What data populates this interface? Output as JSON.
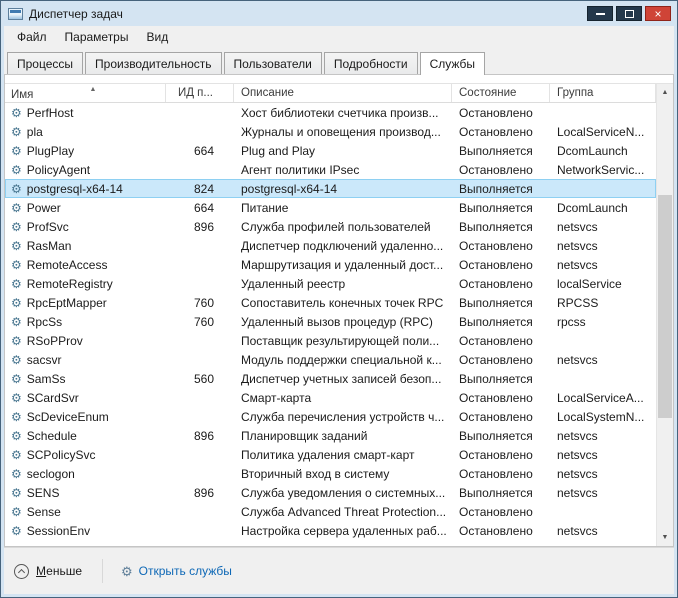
{
  "window": {
    "title": "Диспетчер задач"
  },
  "menu": {
    "items": [
      {
        "label": "Файл"
      },
      {
        "label": "Параметры"
      },
      {
        "label": "Вид"
      }
    ]
  },
  "tabs": {
    "items": [
      {
        "label": "Процессы",
        "active": false
      },
      {
        "label": "Производительность",
        "active": false
      },
      {
        "label": "Пользователи",
        "active": false
      },
      {
        "label": "Подробности",
        "active": false
      },
      {
        "label": "Службы",
        "active": true
      }
    ]
  },
  "table": {
    "columns": [
      {
        "label": "Имя",
        "sort": "asc"
      },
      {
        "label": "ИД п..."
      },
      {
        "label": "Описание"
      },
      {
        "label": "Состояние"
      },
      {
        "label": "Группа"
      }
    ],
    "rows": [
      {
        "name": "PerfHost",
        "pid": "",
        "desc": "Хост библиотеки счетчика произв...",
        "status": "Остановлено",
        "group": "",
        "selected": false
      },
      {
        "name": "pla",
        "pid": "",
        "desc": "Журналы и оповещения производ...",
        "status": "Остановлено",
        "group": "LocalServiceN...",
        "selected": false
      },
      {
        "name": "PlugPlay",
        "pid": "664",
        "desc": "Plug and Play",
        "status": "Выполняется",
        "group": "DcomLaunch",
        "selected": false
      },
      {
        "name": "PolicyAgent",
        "pid": "",
        "desc": "Агент политики IPsec",
        "status": "Остановлено",
        "group": "NetworkServic...",
        "selected": false
      },
      {
        "name": "postgresql-x64-14",
        "pid": "824",
        "desc": "postgresql-x64-14",
        "status": "Выполняется",
        "group": "",
        "selected": true
      },
      {
        "name": "Power",
        "pid": "664",
        "desc": "Питание",
        "status": "Выполняется",
        "group": "DcomLaunch",
        "selected": false
      },
      {
        "name": "ProfSvc",
        "pid": "896",
        "desc": "Служба профилей пользователей",
        "status": "Выполняется",
        "group": "netsvcs",
        "selected": false
      },
      {
        "name": "RasMan",
        "pid": "",
        "desc": "Диспетчер подключений удаленно...",
        "status": "Остановлено",
        "group": "netsvcs",
        "selected": false
      },
      {
        "name": "RemoteAccess",
        "pid": "",
        "desc": "Маршрутизация и удаленный дост...",
        "status": "Остановлено",
        "group": "netsvcs",
        "selected": false
      },
      {
        "name": "RemoteRegistry",
        "pid": "",
        "desc": "Удаленный реестр",
        "status": "Остановлено",
        "group": "localService",
        "selected": false
      },
      {
        "name": "RpcEptMapper",
        "pid": "760",
        "desc": "Сопоставитель конечных точек RPC",
        "status": "Выполняется",
        "group": "RPCSS",
        "selected": false
      },
      {
        "name": "RpcSs",
        "pid": "760",
        "desc": "Удаленный вызов процедур (RPC)",
        "status": "Выполняется",
        "group": "rpcss",
        "selected": false
      },
      {
        "name": "RSoPProv",
        "pid": "",
        "desc": "Поставщик результирующей поли...",
        "status": "Остановлено",
        "group": "",
        "selected": false
      },
      {
        "name": "sacsvr",
        "pid": "",
        "desc": "Модуль поддержки специальной к...",
        "status": "Остановлено",
        "group": "netsvcs",
        "selected": false
      },
      {
        "name": "SamSs",
        "pid": "560",
        "desc": "Диспетчер учетных записей безоп...",
        "status": "Выполняется",
        "group": "",
        "selected": false
      },
      {
        "name": "SCardSvr",
        "pid": "",
        "desc": "Смарт-карта",
        "status": "Остановлено",
        "group": "LocalServiceA...",
        "selected": false
      },
      {
        "name": "ScDeviceEnum",
        "pid": "",
        "desc": "Служба перечисления устройств ч...",
        "status": "Остановлено",
        "group": "LocalSystemN...",
        "selected": false
      },
      {
        "name": "Schedule",
        "pid": "896",
        "desc": "Планировщик заданий",
        "status": "Выполняется",
        "group": "netsvcs",
        "selected": false
      },
      {
        "name": "SCPolicySvc",
        "pid": "",
        "desc": "Политика удаления смарт-карт",
        "status": "Остановлено",
        "group": "netsvcs",
        "selected": false
      },
      {
        "name": "seclogon",
        "pid": "",
        "desc": "Вторичный вход в систему",
        "status": "Остановлено",
        "group": "netsvcs",
        "selected": false
      },
      {
        "name": "SENS",
        "pid": "896",
        "desc": "Служба уведомления о системных...",
        "status": "Выполняется",
        "group": "netsvcs",
        "selected": false
      },
      {
        "name": "Sense",
        "pid": "",
        "desc": "Служба Advanced Threat Protection...",
        "status": "Остановлено",
        "group": "",
        "selected": false
      },
      {
        "name": "SessionEnv",
        "pid": "",
        "desc": "Настройка сервера удаленных раб...",
        "status": "Остановлено",
        "group": "netsvcs",
        "selected": false
      }
    ]
  },
  "footer": {
    "less_accel": "М",
    "less_rest": "еньше",
    "open_services": "Открыть службы"
  },
  "icons": {
    "gear": "⚙",
    "sort_asc": "▲",
    "scroll_up": "▲",
    "scroll_down": "▼",
    "close": "×"
  },
  "colors": {
    "selection_bg": "#cbe8fa",
    "selection_border": "#8ed0f2",
    "link": "#0e68b6",
    "close_button": "#cf4437"
  }
}
